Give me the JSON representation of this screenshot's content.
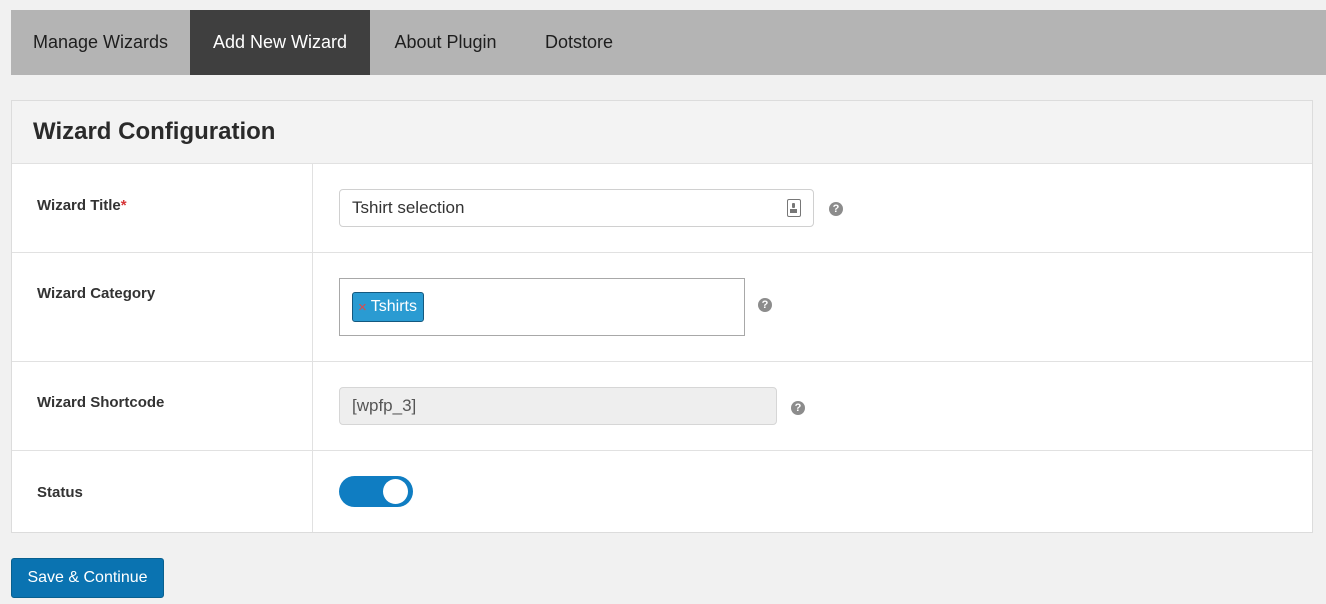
{
  "tabs": [
    {
      "label": "Manage Wizards",
      "active": false
    },
    {
      "label": "Add New Wizard",
      "active": true
    },
    {
      "label": "About Plugin",
      "active": false
    },
    {
      "label": "Dotstore",
      "active": false
    }
  ],
  "panel": {
    "title": "Wizard Configuration",
    "fields": {
      "title": {
        "label": "Wizard Title",
        "required_mark": "*",
        "value": "Tshirt selection",
        "icon": "contact-card-icon"
      },
      "category": {
        "label": "Wizard Category",
        "selected": [
          {
            "label": "Tshirts",
            "remove_glyph": "×"
          }
        ]
      },
      "shortcode": {
        "label": "Wizard Shortcode",
        "value": "[wpfp_3]"
      },
      "status": {
        "label": "Status",
        "enabled": true
      }
    },
    "help_glyph": "?"
  },
  "actions": {
    "save_label": "Save & Continue"
  },
  "colors": {
    "tabbar_bg": "#b4b4b4",
    "active_tab_bg": "#3f3f3f",
    "chip_bg": "#2a9bd2",
    "toggle_on": "#0f7dc2",
    "primary_button": "#0a73b1",
    "required": "#d63638"
  }
}
